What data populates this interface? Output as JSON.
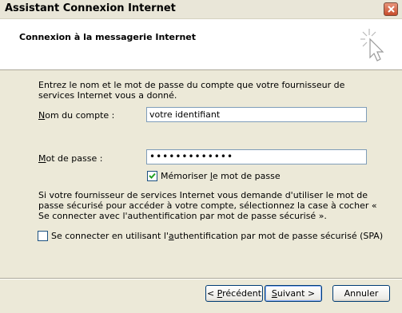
{
  "window": {
    "title": "Assistant Connexion Internet"
  },
  "header": {
    "title": "Connexion à la messagerie Internet"
  },
  "intro": "Entrez le nom et le mot de passe du compte que votre fournisseur de services Internet vous a donné.",
  "account": {
    "label_underlined": "N",
    "label_rest": "om du compte :",
    "value": "votre identifiant"
  },
  "password": {
    "label_underlined": "M",
    "label_rest": "ot de passe :",
    "value": "•••••••••••••"
  },
  "remember": {
    "label_before": "Mémoriser ",
    "label_underlined": "l",
    "label_after": "e mot de passe",
    "checked": true
  },
  "spa_info": "Si votre fournisseur de services Internet vous demande d'utiliser le mot de passe sécurisé pour accéder à votre compte, sélectionnez la case à cocher « Se connecter avec l'authentification par mot de passe sécurisé ».",
  "spa": {
    "label_before": "Se connecter en utilisant l'",
    "label_underlined": "a",
    "label_after": "uthentification par mot de passe sécurisé (SPA)",
    "checked": false
  },
  "buttons": {
    "back_prefix": "< ",
    "back_underlined": "P",
    "back_rest": "récédent",
    "next_underlined": "S",
    "next_rest": "uivant >",
    "cancel": "Annuler"
  },
  "colors": {
    "header_bg": "#FFFFFF",
    "dialog_bg": "#ECE9D8",
    "input_border": "#7F9DB9",
    "check_mark": "#21A121"
  }
}
